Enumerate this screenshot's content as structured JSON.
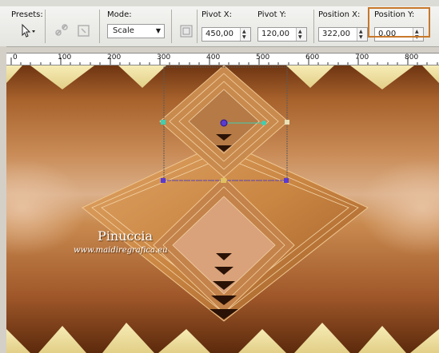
{
  "toolbar": {
    "presets_label": "Presets:",
    "mode_label": "Mode:",
    "mode_value": "Scale",
    "pivot_x_label": "Pivot X:",
    "pivot_x_value": "450,00",
    "pivot_y_label": "Pivot Y:",
    "pivot_y_value": "120,00",
    "position_x_label": "Position X:",
    "position_x_value": "322,00",
    "position_y_label": "Position Y:",
    "position_y_value": "0,00"
  },
  "ruler": {
    "labels": [
      "0",
      "100",
      "200",
      "300",
      "400",
      "500",
      "600",
      "700",
      "800"
    ]
  },
  "watermark": {
    "name": "Pinuccia",
    "url": "www.maidiregrafica.eu"
  },
  "colors": {
    "highlight_box": "#c8782a",
    "wood_mid": "#c98a4c",
    "wood_dark": "#7a3f15",
    "cream": "#f2e3a6",
    "handle_teal": "#3fcfb0",
    "handle_purple": "#5a3ad0"
  },
  "icons": [
    "pointer-icon",
    "chevron-down-icon",
    "link-icon",
    "deform-icon",
    "rectangle-icon",
    "spin-up-icon",
    "spin-down-icon"
  ]
}
